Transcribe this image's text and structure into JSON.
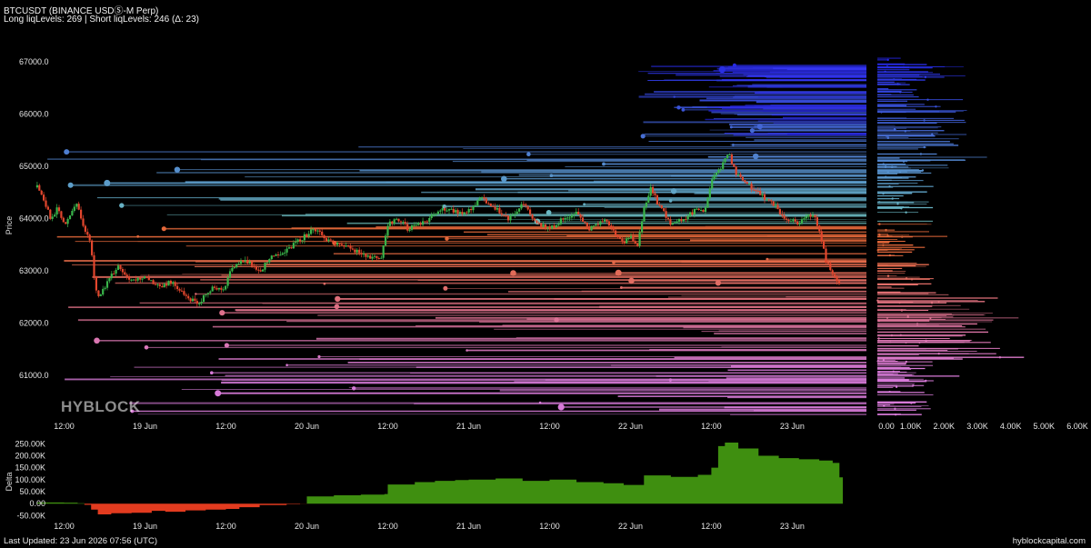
{
  "header": {
    "title": "BTCUSDT (BINANCE USDⓈ-M Perp)",
    "levels_line": "Long liqLevels: 269 | Short liqLevels: 246 (Δ: 23)"
  },
  "watermark": "HYBLOCK",
  "footer": {
    "updated": "Last Updated: 23 Jun 2026 07:56 (UTC)",
    "site": "hyblockcapital.com"
  },
  "colors": {
    "background": "#000000",
    "candle_up": "#39b54a",
    "candle_down": "#e2462d",
    "delta_positive": "#3f8f10",
    "delta_negative": "#e23b1f",
    "short_levels_far": "#2323e6",
    "short_levels_near": "#6fc3c0",
    "long_levels_near": "#e4683a",
    "long_levels_far": "#d77ad8"
  },
  "chart_data": [
    {
      "type": "line",
      "name": "price-panel",
      "ylabel": "Price",
      "ylim": [
        60150,
        67700
      ],
      "y_ticks": [
        "61000.0",
        "62000.0",
        "63000.0",
        "64000.0",
        "65000.0",
        "66000.0",
        "67000.0"
      ],
      "x_ticks": [
        "12:00",
        "19 Jun",
        "12:00",
        "20 Jun",
        "12:00",
        "21 Jun",
        "12:00",
        "22 Jun",
        "12:00",
        "23 Jun"
      ],
      "x_hours": [
        0,
        24,
        48,
        72,
        96,
        120,
        144,
        168,
        192,
        216
      ],
      "x_range_hours": [
        -5,
        238
      ],
      "price_path": [
        [
          -8,
          64600
        ],
        [
          -6,
          64350
        ],
        [
          -4,
          64000
        ],
        [
          -2,
          64200
        ],
        [
          0,
          63900
        ],
        [
          2,
          64100
        ],
        [
          4,
          64300
        ],
        [
          6,
          63800
        ],
        [
          8,
          63500
        ],
        [
          9,
          62800
        ],
        [
          10,
          62500
        ],
        [
          12,
          62700
        ],
        [
          14,
          62900
        ],
        [
          16,
          63100
        ],
        [
          18,
          62950
        ],
        [
          20,
          62800
        ],
        [
          24,
          62900
        ],
        [
          28,
          62700
        ],
        [
          32,
          62800
        ],
        [
          36,
          62500
        ],
        [
          40,
          62400
        ],
        [
          44,
          62700
        ],
        [
          47,
          62600
        ],
        [
          50,
          63100
        ],
        [
          54,
          63200
        ],
        [
          58,
          63000
        ],
        [
          62,
          63300
        ],
        [
          66,
          63400
        ],
        [
          70,
          63600
        ],
        [
          74,
          63800
        ],
        [
          78,
          63600
        ],
        [
          82,
          63500
        ],
        [
          86,
          63400
        ],
        [
          90,
          63300
        ],
        [
          94,
          63200
        ],
        [
          96,
          63900
        ],
        [
          99,
          64000
        ],
        [
          102,
          63800
        ],
        [
          106,
          63900
        ],
        [
          110,
          64100
        ],
        [
          114,
          64200
        ],
        [
          118,
          64100
        ],
        [
          120,
          64150
        ],
        [
          124,
          64400
        ],
        [
          128,
          64200
        ],
        [
          132,
          64000
        ],
        [
          136,
          64300
        ],
        [
          140,
          63900
        ],
        [
          144,
          63800
        ],
        [
          148,
          64000
        ],
        [
          152,
          64100
        ],
        [
          156,
          63800
        ],
        [
          160,
          64000
        ],
        [
          164,
          63700
        ],
        [
          166,
          63500
        ],
        [
          168,
          63700
        ],
        [
          170,
          63400
        ],
        [
          172,
          64200
        ],
        [
          174,
          64600
        ],
        [
          176,
          64300
        ],
        [
          180,
          63900
        ],
        [
          184,
          64000
        ],
        [
          188,
          64200
        ],
        [
          190,
          64100
        ],
        [
          192,
          64700
        ],
        [
          195,
          65000
        ],
        [
          197,
          65300
        ],
        [
          199,
          64900
        ],
        [
          202,
          64700
        ],
        [
          206,
          64500
        ],
        [
          210,
          64300
        ],
        [
          214,
          64000
        ],
        [
          218,
          63900
        ],
        [
          222,
          64100
        ],
        [
          224,
          63800
        ],
        [
          226,
          63200
        ],
        [
          228,
          62900
        ],
        [
          230,
          62800
        ]
      ]
    },
    {
      "type": "bar",
      "name": "liquidation-levels-histogram",
      "x_ticks": [
        "0.00",
        "1.00K",
        "2.00K",
        "3.00K",
        "4.00K",
        "5.00K",
        "6.00K"
      ],
      "xlim": [
        0,
        6000
      ]
    },
    {
      "type": "area",
      "name": "delta-panel",
      "ylabel": "Delta",
      "ylim": [
        -60000,
        270000
      ],
      "y_ticks": [
        "-50.00K",
        "0.00",
        "50.00K",
        "100.00K",
        "150.00K",
        "200.00K",
        "250.00K"
      ],
      "x_ticks": [
        "12:00",
        "19 Jun",
        "12:00",
        "20 Jun",
        "12:00",
        "21 Jun",
        "12:00",
        "22 Jun",
        "12:00",
        "23 Jun"
      ],
      "delta_path": [
        [
          -8,
          5000
        ],
        [
          0,
          4000
        ],
        [
          4,
          2000
        ],
        [
          6,
          -5000
        ],
        [
          8,
          -25000
        ],
        [
          10,
          -45000
        ],
        [
          14,
          -40000
        ],
        [
          20,
          -38000
        ],
        [
          26,
          -30000
        ],
        [
          30,
          -34000
        ],
        [
          36,
          -28000
        ],
        [
          42,
          -25000
        ],
        [
          48,
          -22000
        ],
        [
          52,
          -15000
        ],
        [
          58,
          -6000
        ],
        [
          66,
          -2000
        ],
        [
          70,
          -1000
        ],
        [
          72,
          30000
        ],
        [
          80,
          35000
        ],
        [
          88,
          38000
        ],
        [
          95,
          40000
        ],
        [
          96,
          80000
        ],
        [
          104,
          90000
        ],
        [
          110,
          95000
        ],
        [
          116,
          98000
        ],
        [
          120,
          100000
        ],
        [
          128,
          105000
        ],
        [
          136,
          95000
        ],
        [
          144,
          100000
        ],
        [
          152,
          90000
        ],
        [
          160,
          85000
        ],
        [
          166,
          78000
        ],
        [
          172,
          118000
        ],
        [
          180,
          112000
        ],
        [
          188,
          120000
        ],
        [
          192,
          150000
        ],
        [
          194,
          240000
        ],
        [
          196,
          255000
        ],
        [
          200,
          230000
        ],
        [
          206,
          200000
        ],
        [
          212,
          190000
        ],
        [
          218,
          185000
        ],
        [
          224,
          180000
        ],
        [
          228,
          170000
        ],
        [
          230,
          110000
        ],
        [
          231,
          80000
        ]
      ]
    }
  ]
}
